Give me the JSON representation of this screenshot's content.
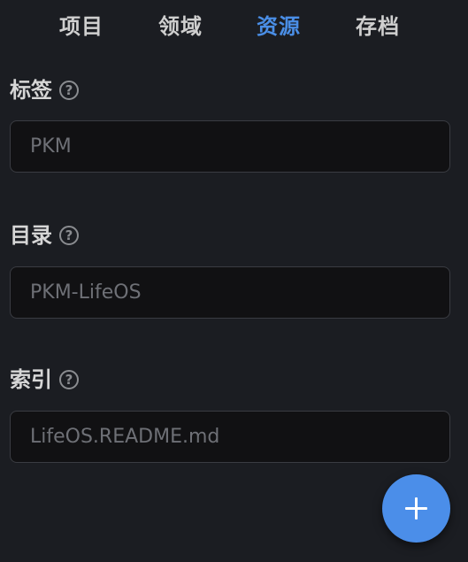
{
  "tabs": [
    {
      "label": "项目",
      "active": false
    },
    {
      "label": "领域",
      "active": false
    },
    {
      "label": "资源",
      "active": true
    },
    {
      "label": "存档",
      "active": false
    }
  ],
  "fields": {
    "tag": {
      "label": "标签",
      "value": "PKM",
      "help_icon": "question-circle-icon"
    },
    "directory": {
      "label": "目录",
      "value": "PKM-LifeOS",
      "help_icon": "question-circle-icon"
    },
    "index": {
      "label": "索引",
      "value": "LifeOS.README.md",
      "help_icon": "question-circle-icon"
    }
  },
  "help_glyph": "?",
  "fab": {
    "icon": "plus-icon"
  },
  "colors": {
    "background": "#1b1d22",
    "active_tab": "#4a8ee6",
    "input_background": "#111113",
    "fab": "#4b8ee9"
  }
}
